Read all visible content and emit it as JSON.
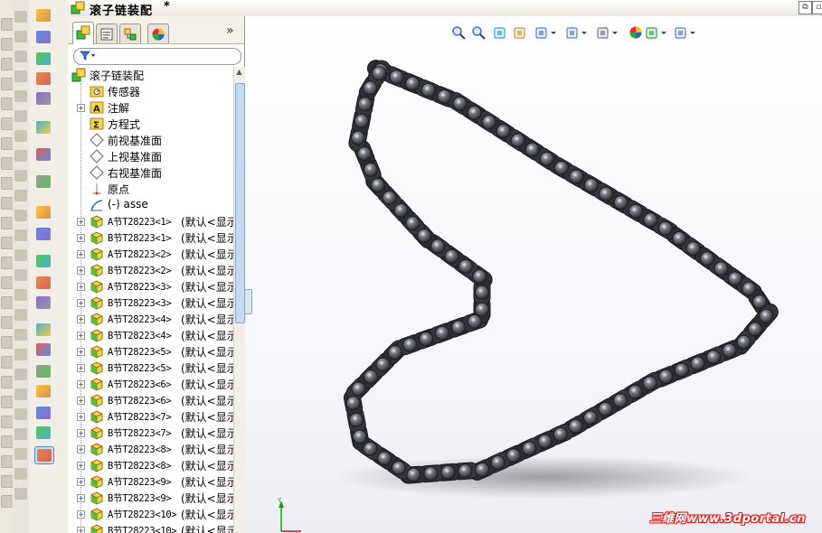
{
  "window": {
    "title": "滚子链装配",
    "modified_marker": "*"
  },
  "feature_manager": {
    "tabs": [
      "feature-manager-tree",
      "property-manager",
      "configuration-manager",
      "display-manager"
    ],
    "more_label": "»",
    "filter_placeholder": "",
    "tree": [
      {
        "label": "滚子链装配",
        "icon": "assembly-icon",
        "expander": false,
        "indent": 0
      },
      {
        "label": "传感器",
        "icon": "sensor-folder-icon",
        "expander": false,
        "indent": 1
      },
      {
        "label": "注解",
        "icon": "annotation-folder-icon",
        "expander": true,
        "indent": 1
      },
      {
        "label": "方程式",
        "icon": "equation-folder-icon",
        "expander": false,
        "indent": 1
      },
      {
        "label": "前视基准面",
        "icon": "plane-icon",
        "expander": false,
        "indent": 1
      },
      {
        "label": "上视基准面",
        "icon": "plane-icon",
        "expander": false,
        "indent": 1
      },
      {
        "label": "右视基准面",
        "icon": "plane-icon",
        "expander": false,
        "indent": 1
      },
      {
        "label": "原点",
        "icon": "origin-icon",
        "expander": false,
        "indent": 1
      },
      {
        "label": "(-) asse",
        "icon": "sketch-icon",
        "expander": false,
        "indent": 1
      },
      {
        "label": "A节T28223<1>",
        "suffix": "(默认<显示",
        "icon": "part-icon",
        "expander": true,
        "indent": 1
      },
      {
        "label": "B节T28223<1>",
        "suffix": "(默认<显示",
        "icon": "part-icon",
        "expander": true,
        "indent": 1
      },
      {
        "label": "A节T28223<2>",
        "suffix": "(默认<显示",
        "icon": "part-icon",
        "expander": true,
        "indent": 1
      },
      {
        "label": "B节T28223<2>",
        "suffix": "(默认<显示",
        "icon": "part-icon",
        "expander": true,
        "indent": 1
      },
      {
        "label": "A节T28223<3>",
        "suffix": "(默认<显示",
        "icon": "part-icon",
        "expander": true,
        "indent": 1
      },
      {
        "label": "B节T28223<3>",
        "suffix": "(默认<显示",
        "icon": "part-icon",
        "expander": true,
        "indent": 1
      },
      {
        "label": "A节T28223<4>",
        "suffix": "(默认<显示",
        "icon": "part-icon",
        "expander": true,
        "indent": 1
      },
      {
        "label": "B节T28223<4>",
        "suffix": "(默认<显示",
        "icon": "part-icon",
        "expander": true,
        "indent": 1
      },
      {
        "label": "A节T28223<5>",
        "suffix": "(默认<显示",
        "icon": "part-icon",
        "expander": true,
        "indent": 1
      },
      {
        "label": "B节T28223<5>",
        "suffix": "(默认<显示",
        "icon": "part-icon",
        "expander": true,
        "indent": 1
      },
      {
        "label": "A节T28223<6>",
        "suffix": "(默认<显示",
        "icon": "part-icon",
        "expander": true,
        "indent": 1
      },
      {
        "label": "B节T28223<6>",
        "suffix": "(默认<显示",
        "icon": "part-icon",
        "expander": true,
        "indent": 1
      },
      {
        "label": "A节T28223<7>",
        "suffix": "(默认<显示",
        "icon": "part-icon",
        "expander": true,
        "indent": 1
      },
      {
        "label": "B节T28223<7>",
        "suffix": "(默认<显示",
        "icon": "part-icon",
        "expander": true,
        "indent": 1
      },
      {
        "label": "A节T28223<8>",
        "suffix": "(默认<显示",
        "icon": "part-icon",
        "expander": true,
        "indent": 1
      },
      {
        "label": "B节T28223<8>",
        "suffix": "(默认<显示",
        "icon": "part-icon",
        "expander": true,
        "indent": 1
      },
      {
        "label": "A节T28223<9>",
        "suffix": "(默认<显示",
        "icon": "part-icon",
        "expander": true,
        "indent": 1
      },
      {
        "label": "B节T28223<9>",
        "suffix": "(默认<显示",
        "icon": "part-icon",
        "expander": true,
        "indent": 1
      },
      {
        "label": "A节T28223<10>",
        "suffix": "(默认<显示",
        "icon": "part-icon",
        "expander": true,
        "indent": 1
      },
      {
        "label": "B节T28223<10>",
        "suffix": "(默认<显示",
        "icon": "part-icon",
        "expander": true,
        "indent": 1
      }
    ]
  },
  "heads_up_toolbar": {
    "icons": [
      "zoom-to-fit-icon",
      "zoom-area-icon",
      "previous-view-icon",
      "section-view-icon",
      "view-orientation-icon",
      "display-style-icon",
      "hide-show-items-icon",
      "edit-appearance-icon",
      "apply-scene-icon",
      "view-settings-icon"
    ]
  },
  "watermark": {
    "text": "三维网www.3dportal.cn"
  },
  "colors": {
    "accent_green": "#3cbd3c",
    "folder_yellow": "#f5d44a",
    "chain_dark": "#3b3d42",
    "watermark_red": "#d11111"
  }
}
